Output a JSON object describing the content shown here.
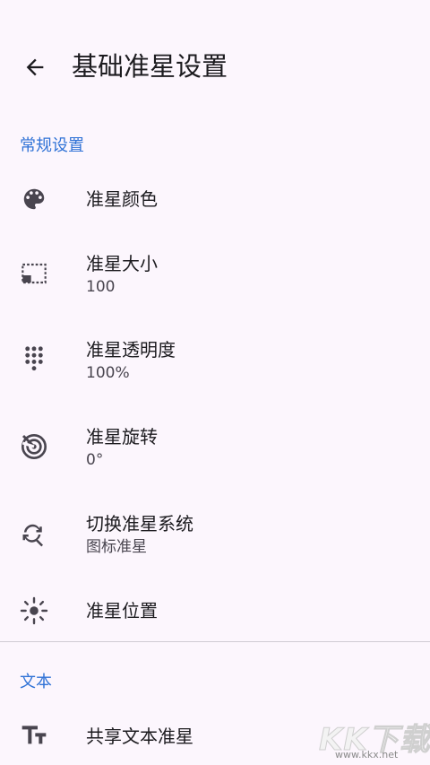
{
  "header": {
    "title": "基础准星设置",
    "back_icon": "arrow-left-icon"
  },
  "sections": [
    {
      "title": "常规设置",
      "items": [
        {
          "icon": "palette-icon",
          "label": "准星颜色",
          "value": ""
        },
        {
          "icon": "aspect-ratio-icon",
          "label": "准星大小",
          "value": "100"
        },
        {
          "icon": "dot-grid-icon",
          "label": "准星透明度",
          "value": "100%"
        },
        {
          "icon": "radar-icon",
          "label": "准星旋转",
          "value": "0°"
        },
        {
          "icon": "swap-search-icon",
          "label": "切换准星系统",
          "value": "图标准星"
        },
        {
          "icon": "center-focus-icon",
          "label": "准星位置",
          "value": ""
        }
      ]
    },
    {
      "title": "文本",
      "items": [
        {
          "icon": "text-size-icon",
          "label": "共享文本准星",
          "value": ""
        }
      ]
    }
  ],
  "watermark": {
    "text": "KK下载",
    "url": "www.kkx.net"
  },
  "colors": {
    "accent": "#2f72d6",
    "background": "#fcf6fd",
    "icon": "#49454f"
  }
}
